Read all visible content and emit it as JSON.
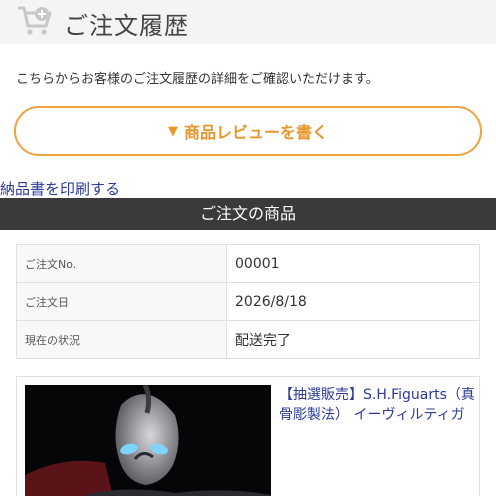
{
  "header": {
    "title": "ご注文履歴",
    "icon": "cart-icon"
  },
  "intro": {
    "text": "こちらからお客様のご注文履歴の詳細をご確認いただけます。"
  },
  "review_button": {
    "icon": "▼",
    "label": "商品レビューを書く"
  },
  "print_link": {
    "label": "納品書を印刷する"
  },
  "section": {
    "title": "ご注文の商品"
  },
  "order_info": {
    "rows": [
      {
        "label": "ご注文No.",
        "value": "00001"
      },
      {
        "label": "ご注文日",
        "value": "2026/8/18"
      },
      {
        "label": "現在の状況",
        "value": "配送完了"
      }
    ]
  },
  "product": {
    "name": "【抽選販売】S.H.Figuarts（真骨彫製法） イーヴィルティガ"
  },
  "colors": {
    "accent": "#f0a340",
    "link": "#2a3a9a",
    "bar": "#3a3a3a"
  }
}
